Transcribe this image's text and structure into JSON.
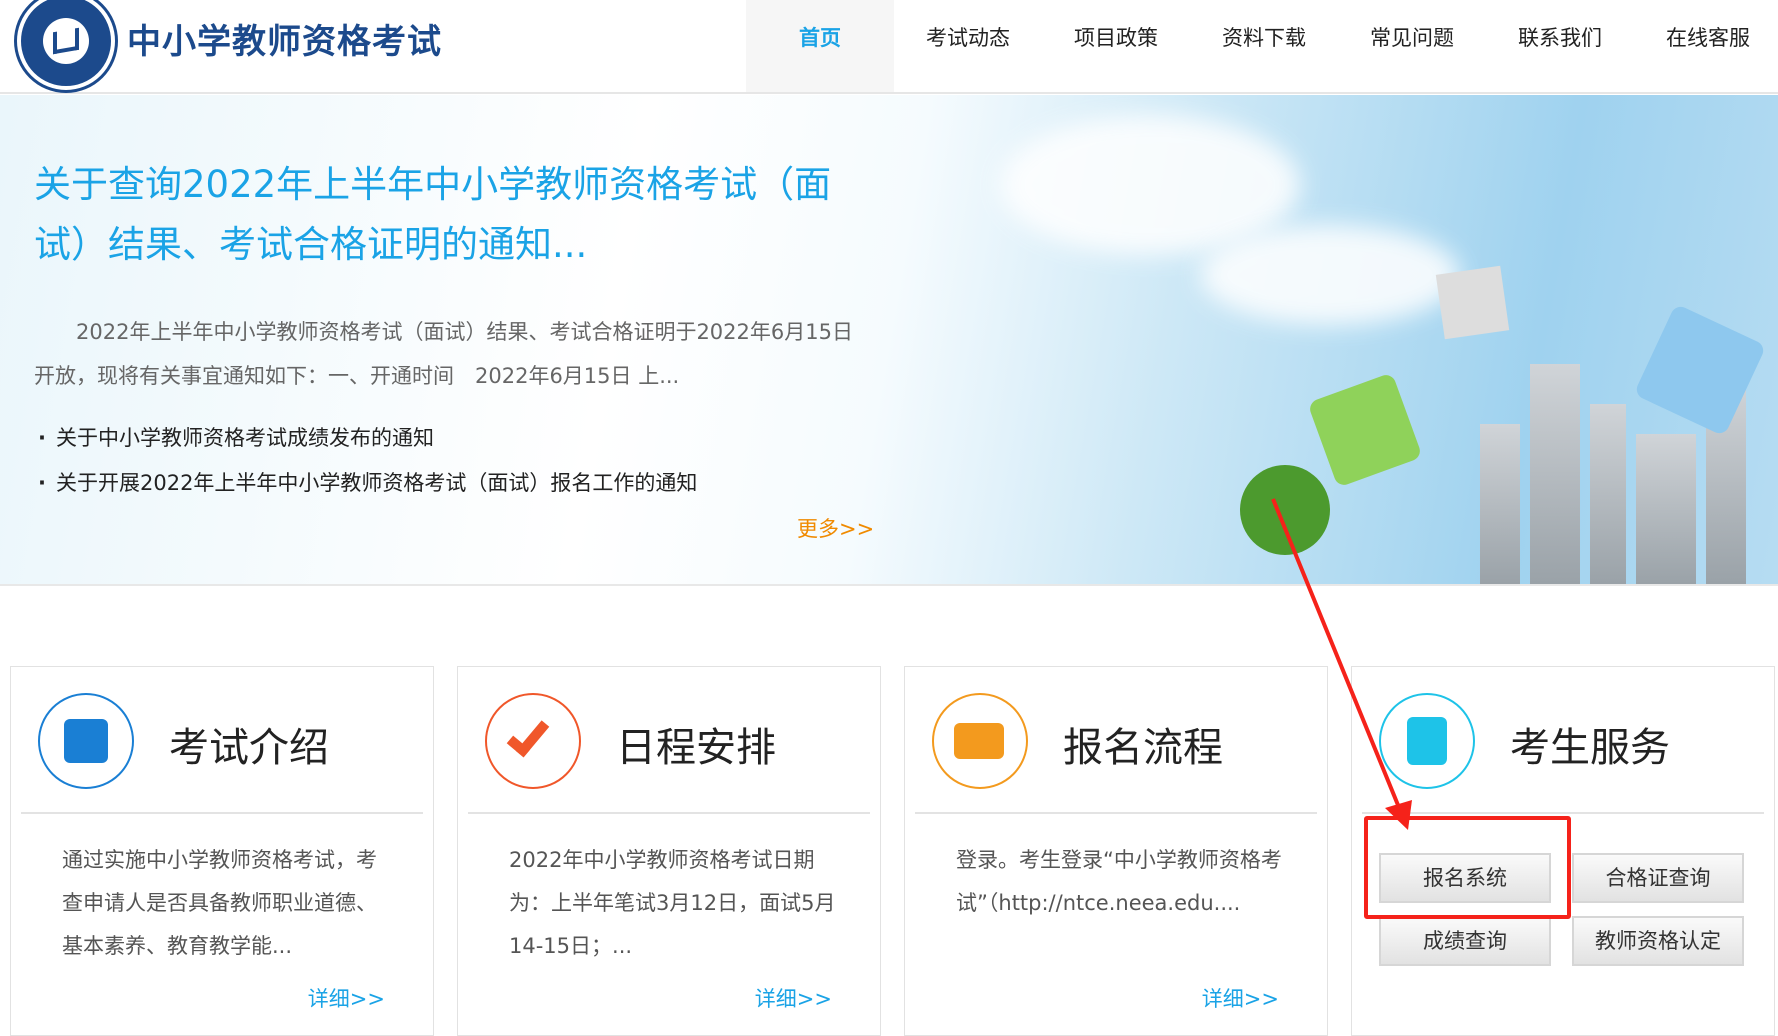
{
  "header": {
    "site_title": "中小学教师资格考试",
    "nav": [
      "首页",
      "考试动态",
      "项目政策",
      "资料下载",
      "常见问题",
      "联系我们",
      "在线客服"
    ],
    "active_nav": "首页"
  },
  "banner": {
    "headline": "关于查询2022年上半年中小学教师资格考试（面试）结果、考试合格证明的通知...",
    "summary": "2022年上半年中小学教师资格考试（面试）结果、考试合格证明于2022年6月15日开放，现将有关事宜通知如下：一、开通时间　2022年6月15日 上...",
    "links": [
      "关于中小学教师资格考试成绩发布的通知",
      "关于开展2022年上半年中小学教师资格考试（面试）报名工作的通知"
    ],
    "more": "更多>>"
  },
  "cards": [
    {
      "title": "考试介绍",
      "body": "通过实施中小学教师资格考试，考查申请人是否具备教师职业道德、基本素养、教育教学能...",
      "detail": "详细>>",
      "icon": "document-edit-icon",
      "color": "#1a7fd4"
    },
    {
      "title": "日程安排",
      "body": "2022年中小学教师资格考试日期为：上半年笔试3月12日，面试5月14-15日；...",
      "detail": "详细>>",
      "icon": "checkmark-icon",
      "color": "#f0572a"
    },
    {
      "title": "报名流程",
      "body": "登录。考生登录“中小学教师资格考试”（http://ntce.neea.edu....",
      "detail": "详细>>",
      "icon": "form-pen-icon",
      "color": "#f39a1e"
    },
    {
      "title": "考生服务",
      "icon": "contact-book-icon",
      "color": "#1ec3e8",
      "buttons": [
        "报名系统",
        "合格证查询",
        "成绩查询",
        "教师资格认定"
      ]
    }
  ],
  "annotation": {
    "color": "#f5221a"
  }
}
